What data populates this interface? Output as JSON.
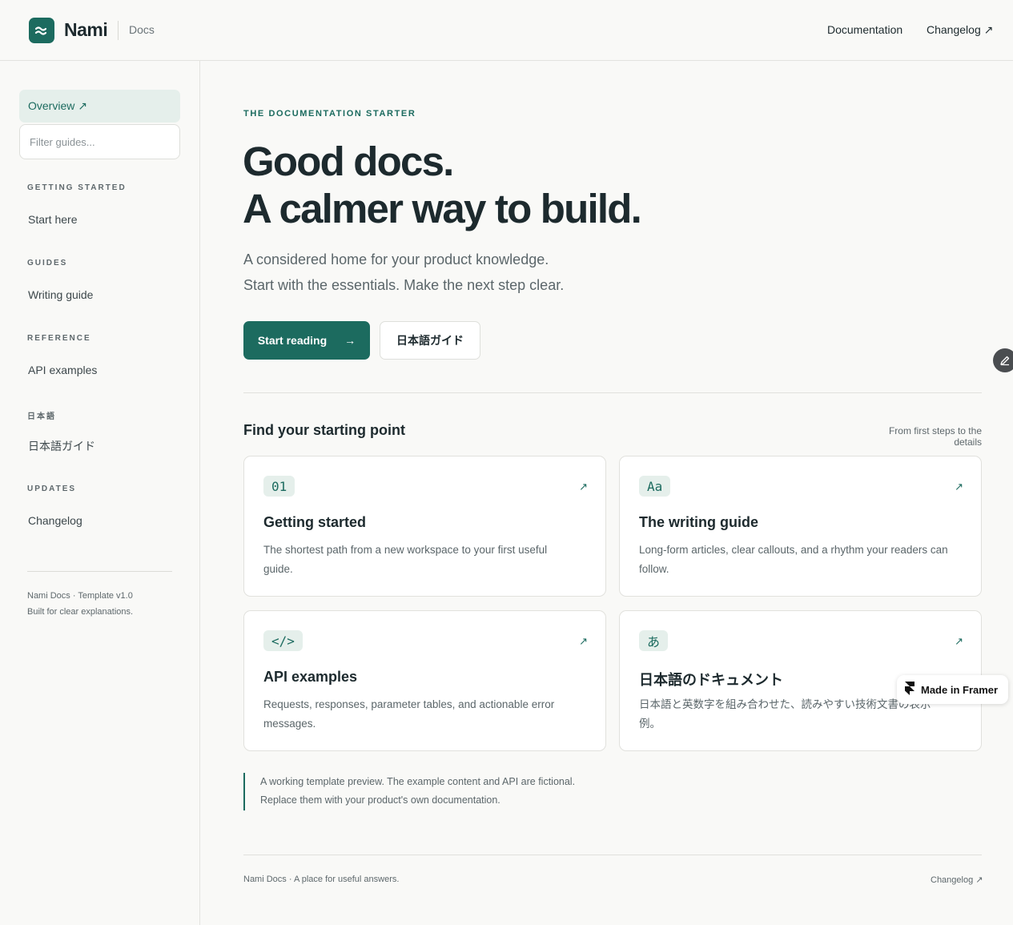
{
  "header": {
    "brand": "Nami",
    "brand_sub": "Docs",
    "nav": {
      "documentation": "Documentation",
      "changelog": "Changelog ↗"
    }
  },
  "sidebar": {
    "overview": "Overview ↗",
    "filter_placeholder": "Filter guides...",
    "sections": [
      {
        "title": "GETTING STARTED",
        "link": "Start here"
      },
      {
        "title": "GUIDES",
        "link": "Writing guide"
      },
      {
        "title": "REFERENCE",
        "link": "API examples"
      },
      {
        "title": "日本語",
        "link": "日本語ガイド"
      },
      {
        "title": "UPDATES",
        "link": "Changelog"
      }
    ],
    "footer": {
      "line1": "Nami Docs · Template v1.0",
      "line2": "Built for clear explanations."
    }
  },
  "main": {
    "eyebrow": "THE DOCUMENTATION STARTER",
    "hero_line1": "Good docs.",
    "hero_line2": "A calmer way to build.",
    "lede_line1": "A considered home for your product knowledge.",
    "lede_line2": "Start with the essentials. Make the next step clear.",
    "primary_button": "Start reading",
    "primary_arrow": "→",
    "secondary_button": "日本語ガイド",
    "section_title": "Find your starting point",
    "section_note": "From first steps to the details",
    "cards": [
      {
        "badge": "01",
        "title": "Getting started",
        "desc": "The shortest path from a new workspace to your first useful guide.",
        "arrow": "↗"
      },
      {
        "badge": "Aa",
        "title": "The writing guide",
        "desc": "Long-form articles, clear callouts, and a rhythm your readers can follow.",
        "arrow": "↗"
      },
      {
        "badge": "</>",
        "title": "API examples",
        "desc": "Requests, responses, parameter tables, and actionable error messages.",
        "arrow": "↗"
      },
      {
        "badge": "あ",
        "title": "日本語のドキュメント",
        "desc": "日本語と英数字を組み合わせた、読みやすい技術文書の表示例。",
        "arrow": "↗"
      }
    ],
    "callout_line1": "A working template preview. The example content and API are fictional.",
    "callout_line2": "Replace them with your product's own documentation.",
    "footer_left": "Nami Docs · A place for useful answers.",
    "footer_right": "Changelog ↗"
  },
  "framer_badge": "Made in Framer",
  "colors": {
    "accent": "#1c6b5f",
    "accent_soft": "#e5efeb",
    "background": "#f9f9f7",
    "text": "#1d2a2e"
  },
  "icons": {
    "logo": "wave-icon",
    "edit": "pencil-icon",
    "framer": "framer-icon"
  }
}
